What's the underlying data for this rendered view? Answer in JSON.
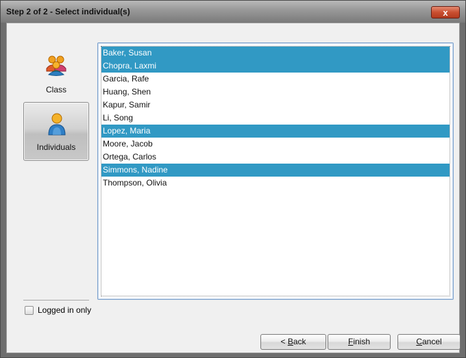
{
  "window": {
    "title": "Step 2 of 2 - Select individual(s)",
    "close_label": "x"
  },
  "nav": {
    "items": [
      {
        "label": "Class",
        "icon": "group-icon",
        "selected": false
      },
      {
        "label": "Individuals",
        "icon": "person-icon",
        "selected": true
      }
    ]
  },
  "list": {
    "items": [
      {
        "label": "Baker, Susan",
        "selected": true
      },
      {
        "label": "Chopra, Laxmi",
        "selected": true
      },
      {
        "label": "Garcia, Rafe",
        "selected": false
      },
      {
        "label": "Huang, Shen",
        "selected": false
      },
      {
        "label": "Kapur, Samir",
        "selected": false
      },
      {
        "label": "Li, Song",
        "selected": false
      },
      {
        "label": "Lopez, Maria",
        "selected": true
      },
      {
        "label": "Moore, Jacob",
        "selected": false
      },
      {
        "label": "Ortega, Carlos",
        "selected": false
      },
      {
        "label": "Simmons, Nadine",
        "selected": true
      },
      {
        "label": "Thompson, Olivia",
        "selected": false
      }
    ]
  },
  "options": {
    "logged_in_only_label": "Logged in only",
    "logged_in_only_checked": false
  },
  "buttons": {
    "back_prefix": "< ",
    "back_mnemonic": "B",
    "back_rest": "ack",
    "finish_mnemonic": "F",
    "finish_rest": "inish",
    "cancel_mnemonic": "C",
    "cancel_rest": "ancel"
  },
  "colors": {
    "selection": "#3199c4",
    "close_button": "#c94f31",
    "list_border": "#7da2ce"
  }
}
